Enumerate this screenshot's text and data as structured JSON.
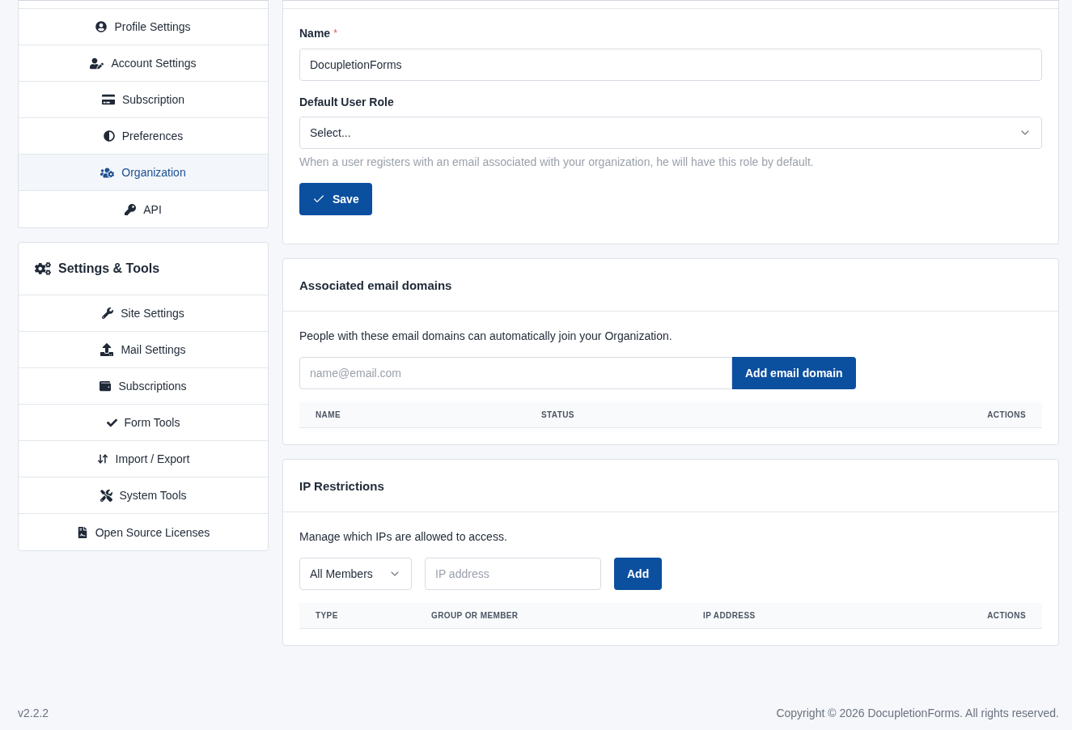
{
  "sidebar": {
    "account_menu": [
      {
        "label": "Profile Settings",
        "selected": false
      },
      {
        "label": "Account Settings",
        "selected": false
      },
      {
        "label": "Subscription",
        "selected": false
      },
      {
        "label": "Preferences",
        "selected": false
      },
      {
        "label": "Organization",
        "selected": true
      },
      {
        "label": "API",
        "selected": false
      }
    ],
    "tools_menu": {
      "title": "Settings & Tools",
      "items": [
        {
          "label": "Site Settings",
          "selected": false
        },
        {
          "label": "Mail Settings",
          "selected": false
        },
        {
          "label": "Subscriptions",
          "selected": false
        },
        {
          "label": "Form Tools",
          "selected": false
        },
        {
          "label": "Import / Export",
          "selected": false
        },
        {
          "label": "System Tools",
          "selected": false
        },
        {
          "label": "Open Source Licenses",
          "selected": false
        }
      ]
    }
  },
  "organization_form": {
    "name_label": "Name",
    "required_mark": "*",
    "name_field": {
      "value": "DocupletionForms"
    },
    "role_label": "Default User Role",
    "role_select": {
      "placeholder": "Select..."
    },
    "role_help": "When a user registers with an email associated with your organization, he will have this role by default.",
    "save_button": "Save"
  },
  "email_domains": {
    "title": "Associated email domains",
    "description": "People with these email domains can automatically join your Organization.",
    "domain_field": {
      "placeholder": "name@email.com"
    },
    "add_button": "Add email domain",
    "table": {
      "columns": [
        "NAME",
        "STATUS",
        "ACTIONS"
      ]
    }
  },
  "ip_restrictions": {
    "title": "IP Restrictions",
    "description": "Manage which IPs are allowed to access.",
    "member_select": {
      "value": "All Members"
    },
    "ip_field": {
      "placeholder": "IP address"
    },
    "add_button": "Add",
    "table": {
      "columns": [
        "TYPE",
        "GROUP OR MEMBER",
        "IP ADDRESS",
        "ACTIONS"
      ]
    }
  },
  "footer": {
    "version": "v2.2.2",
    "copyright": "Copyright © 2026 DocupletionForms. All rights reserved."
  }
}
